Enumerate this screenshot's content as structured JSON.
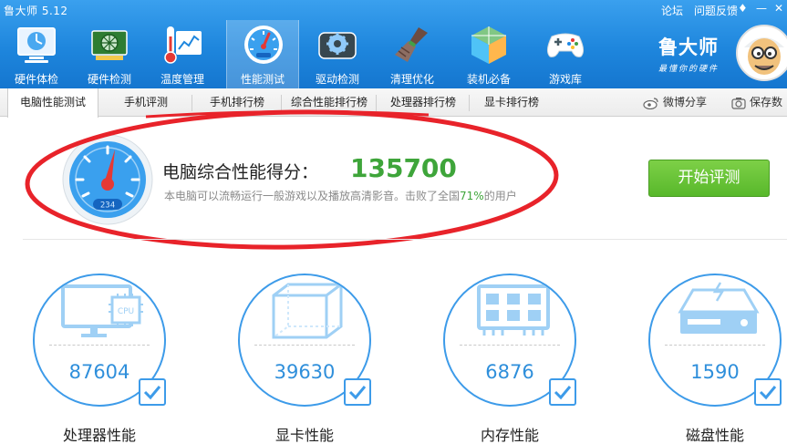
{
  "window": {
    "title": "鲁大师 5.12",
    "links": [
      "论坛",
      "问题反馈"
    ],
    "controls": [
      "♦",
      "—",
      "✕"
    ]
  },
  "toolbar": {
    "items": [
      {
        "label": "硬件体检",
        "icon": "monitor-clock-icon"
      },
      {
        "label": "硬件检测",
        "icon": "graphics-card-icon"
      },
      {
        "label": "温度管理",
        "icon": "thermometer-chart-icon"
      },
      {
        "label": "性能测试",
        "icon": "speedometer-icon"
      },
      {
        "label": "驱动检测",
        "icon": "driver-gear-icon"
      },
      {
        "label": "清理优化",
        "icon": "broom-icon"
      },
      {
        "label": "装机必备",
        "icon": "package-cube-icon"
      },
      {
        "label": "游戏库",
        "icon": "gamepad-icon"
      }
    ],
    "active_index": 3
  },
  "brand": {
    "name": "鲁大师",
    "slogan": "最懂你的硬件"
  },
  "tabs": {
    "items": [
      "电脑性能测试",
      "手机评测",
      "手机排行榜",
      "综合性能排行榜",
      "处理器排行榜",
      "显卡排行榜"
    ],
    "active_index": 0,
    "share_weibo": "微博分享",
    "save": "保存数"
  },
  "score": {
    "label": "电脑综合性能得分：",
    "value": "135700",
    "gauge_text": "234",
    "desc_prefix": "本电脑可以流畅运行一般游戏以及播放高清影音。击败了全国",
    "desc_pct": "71%",
    "desc_suffix": "的用户",
    "start_button": "开始评测"
  },
  "components": [
    {
      "name": "处理器性能",
      "score": "87604",
      "icon": "cpu-monitor-icon",
      "checked": true
    },
    {
      "name": "显卡性能",
      "score": "39630",
      "icon": "cube-icon",
      "checked": true
    },
    {
      "name": "内存性能",
      "score": "6876",
      "icon": "memory-chip-icon",
      "checked": true
    },
    {
      "name": "磁盘性能",
      "score": "1590",
      "icon": "hard-disk-icon",
      "checked": true
    }
  ],
  "colors": {
    "toolbar_blue": "#1e86dd",
    "score_green": "#3ea53a",
    "card_blue": "#3d9be9",
    "highlight_red": "#e8232a"
  }
}
